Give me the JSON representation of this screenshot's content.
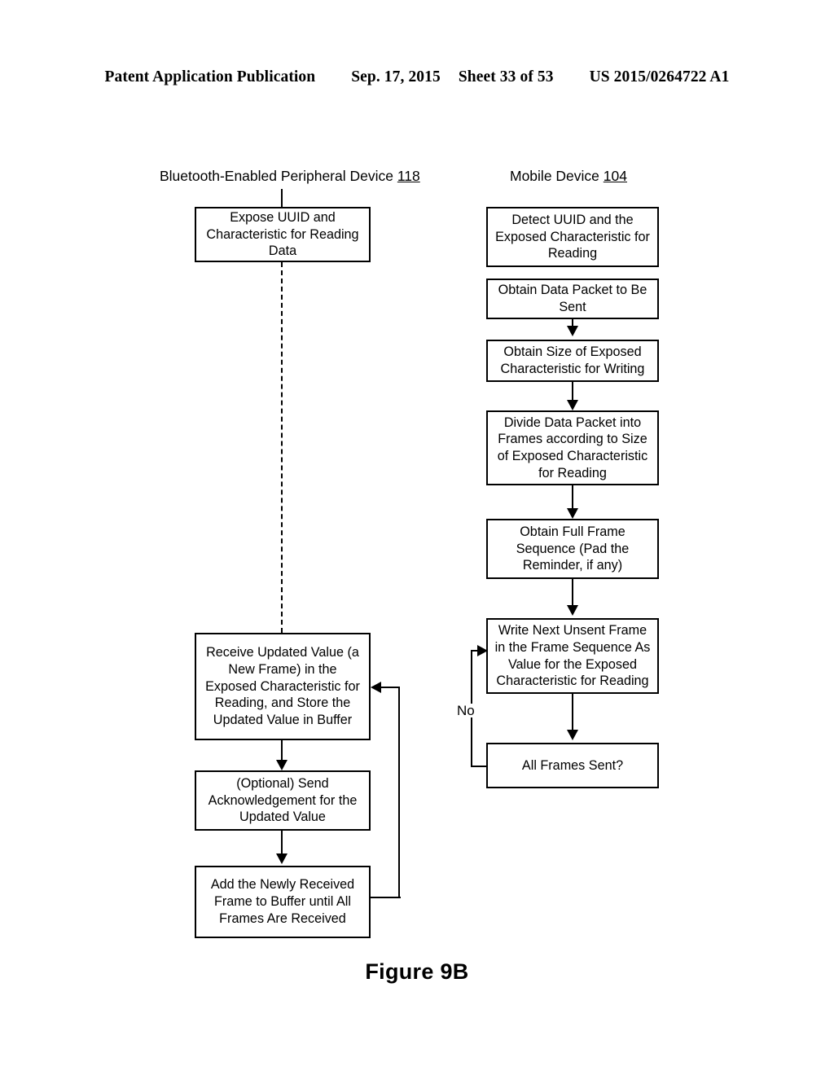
{
  "header": {
    "publication": "Patent Application Publication",
    "date": "Sep. 17, 2015",
    "sheet": "Sheet 33 of 53",
    "patent_number": "US 2015/0264722 A1"
  },
  "figure": {
    "caption": "Figure 9B"
  },
  "columns": {
    "left": {
      "label": "Bluetooth-Enabled Peripheral Device ",
      "ref": "118"
    },
    "right": {
      "label": "Mobile Device ",
      "ref": "104"
    }
  },
  "left_steps": [
    {
      "id": "expose-uuid",
      "text": "Expose UUID and\nCharacteristic for Reading\nData"
    },
    {
      "id": "receive-updated-value",
      "text": "Receive Updated Value (a\nNew Frame) in the\nExposed Characteristic for\nReading, and Store the\nUpdated Value in Buffer"
    },
    {
      "id": "send-acknowledgement",
      "text": "(Optional) Send\nAcknowledgement for the\nUpdated Value"
    },
    {
      "id": "add-frame-to-buffer",
      "text": "Add the Newly Received\nFrame to Buffer until All\nFrames Are Received"
    }
  ],
  "right_steps": [
    {
      "id": "detect-uuid",
      "text": "Detect UUID and the\nExposed Characteristic for\nReading"
    },
    {
      "id": "obtain-data-packet",
      "text": "Obtain Data Packet to Be\nSent"
    },
    {
      "id": "obtain-size",
      "text": "Obtain Size of Exposed\nCharacteristic for Writing"
    },
    {
      "id": "divide-data-packet",
      "text": "Divide Data Packet into\nFrames according to Size\nof Exposed Characteristic\nfor Reading"
    },
    {
      "id": "obtain-full-frame-sequence",
      "text": "Obtain Full Frame\nSequence (Pad the\nReminder, if any)"
    },
    {
      "id": "write-next-unsent-frame",
      "text": "Write Next Unsent Frame\nin the Frame Sequence As\nValue for the Exposed\nCharacteristic for Reading"
    },
    {
      "id": "all-frames-sent",
      "text": "All Frames Sent?"
    }
  ],
  "edge_labels": {
    "no": "No"
  },
  "colors": {
    "stroke": "#000000",
    "background": "#ffffff"
  }
}
